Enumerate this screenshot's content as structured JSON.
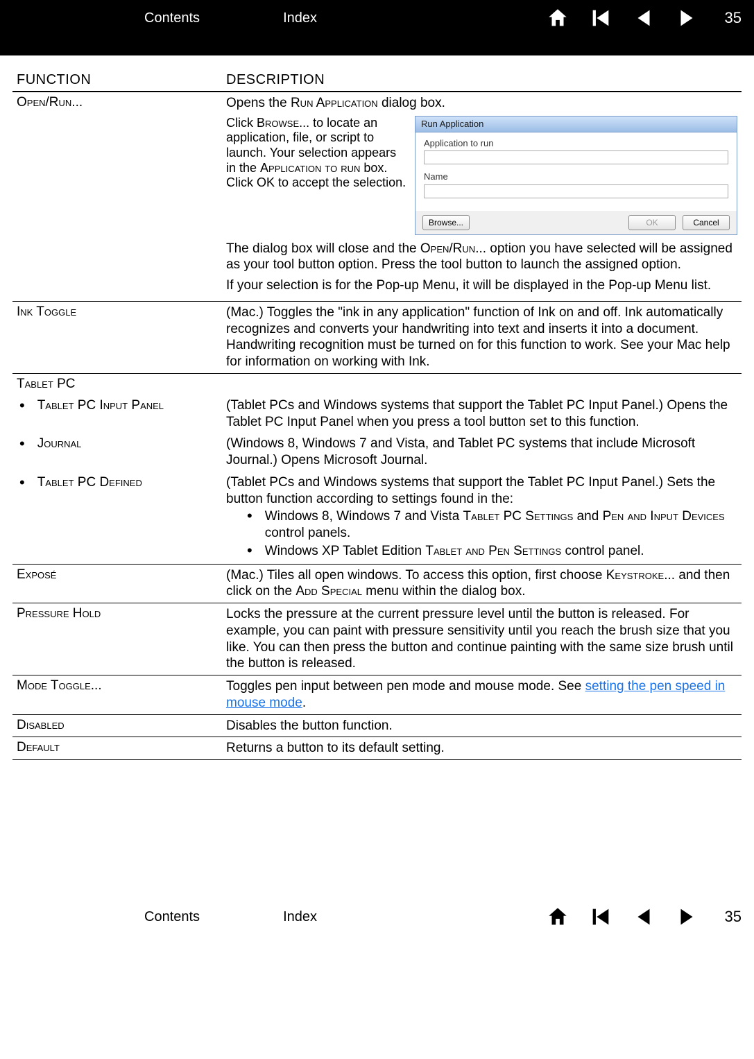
{
  "nav": {
    "contents": "Contents",
    "index": "Index",
    "page": "35"
  },
  "headers": {
    "function": "FUNCTION",
    "description": "DESCRIPTION"
  },
  "rows": {
    "openrun": {
      "label": "Open/Run...",
      "line1_a": "Opens the ",
      "line1_sc": "Run Application",
      "line1_b": " dialog box.",
      "sidetext_a": "Click ",
      "sidetext_sc1": "Browse",
      "sidetext_b": "... to locate an application, file, or script to launch. Your selection appears in the ",
      "sidetext_sc2": "Application to run",
      "sidetext_c": " box. Click OK to accept the selection.",
      "para2_a": "The dialog box will close and the ",
      "para2_sc": "Open/Run",
      "para2_b": "... option you have selected will be assigned as your tool button option. Press the tool button to launch the assigned option.",
      "para3": "If your selection is for the Pop-up Menu, it will be displayed in the Pop-up Menu list."
    },
    "ink": {
      "label": "Ink Toggle",
      "desc": "(Mac.) Toggles the \"ink in any application\" function of Ink on and off. Ink automatically recognizes and converts your handwriting into text and inserts it into a document. Handwriting recognition must be turned on for this function to work. See your Mac help for information on working with Ink."
    },
    "tabletpc": {
      "label": "Tablet PC",
      "sub1_label": "Tablet PC Input Panel",
      "sub1_desc": "(Tablet PCs and Windows systems that support the Tablet PC Input Panel.) Opens the Tablet PC Input Panel when you press a tool button set to this function.",
      "sub2_label": "Journal",
      "sub2_desc": "(Windows 8, Windows 7 and Vista, and Tablet PC systems that include Microsoft Journal.) Opens Microsoft Journal.",
      "sub3_label": "Tablet PC Defined",
      "sub3_desc": "(Tablet PCs and Windows systems that support the Tablet PC Input Panel.) Sets the button function according to settings found in the:",
      "sub3_b1_a": "Windows 8, Windows 7 and Vista ",
      "sub3_b1_sc1": "Tablet PC Settings",
      "sub3_b1_b": " and ",
      "sub3_b1_sc2": "Pen and Input Devices",
      "sub3_b1_c": " control panels.",
      "sub3_b2_a": "Windows XP Tablet Edition ",
      "sub3_b2_sc": "Tablet and Pen Settings",
      "sub3_b2_b": " control panel."
    },
    "expose": {
      "label": "Exposé",
      "desc_a": "(Mac.) Tiles all open windows. To access this option, first choose ",
      "desc_sc1": "Keystroke",
      "desc_b": "... and then click on the ",
      "desc_sc2": "Add Special",
      "desc_c": " menu within the dialog box."
    },
    "pressure": {
      "label": "Pressure Hold",
      "desc": "Locks the pressure at the current pressure level until the button is released. For example, you can paint with pressure sensitivity until you reach the brush size that you like. You can then press the button and continue painting with the same size brush until the button is released."
    },
    "mode": {
      "label": "Mode Toggle...",
      "desc_a": "Toggles pen input between pen mode and mouse mode. See ",
      "link": "setting the pen speed in mouse mode",
      "desc_b": "."
    },
    "disabled": {
      "label": "Disabled",
      "desc": "Disables the button function."
    },
    "default": {
      "label": "Default",
      "desc": "Returns a button to its default setting."
    }
  },
  "dialog": {
    "title": "Run Application",
    "label1": "Application to run",
    "label2": "Name",
    "browse": "Browse...",
    "ok": "OK",
    "cancel": "Cancel"
  }
}
